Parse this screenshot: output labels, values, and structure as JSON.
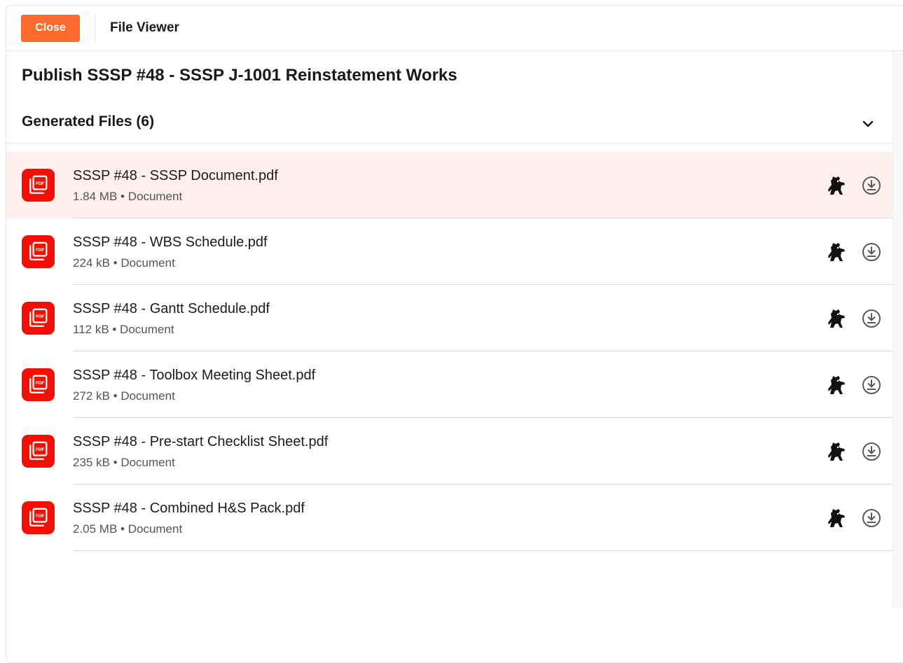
{
  "header": {
    "close_label": "Close",
    "title": "File Viewer"
  },
  "page": {
    "title": "Publish SSSP #48 - SSSP J-1001 Reinstatement Works"
  },
  "section": {
    "title": "Generated Files (6)",
    "toggle_icon": "chevron-down-icon"
  },
  "files": [
    {
      "name": "SSSP #48 - SSSP Document.pdf",
      "meta": "1.84 MB • Document",
      "icon": "pdf-icon"
    },
    {
      "name": "SSSP #48 - WBS Schedule.pdf",
      "meta": "224 kB • Document",
      "icon": "pdf-icon"
    },
    {
      "name": "SSSP #48 - Gantt Schedule.pdf",
      "meta": "112 kB • Document",
      "icon": "pdf-icon"
    },
    {
      "name": "SSSP #48 - Toolbox Meeting Sheet.pdf",
      "meta": "272 kB • Document",
      "icon": "pdf-icon"
    },
    {
      "name": "SSSP #48 - Pre-start Checklist Sheet.pdf",
      "meta": "235 kB • Document",
      "icon": "pdf-icon"
    },
    {
      "name": "SSSP #48 - Combined H&S Pack.pdf",
      "meta": "2.05 MB • Document",
      "icon": "pdf-icon"
    }
  ],
  "row_action_icons": [
    "datadog-icon",
    "download-icon"
  ],
  "colors": {
    "accent": "#ff6b2c",
    "pdf_red": "#f40f02",
    "highlight_row": "#fff0ec"
  }
}
